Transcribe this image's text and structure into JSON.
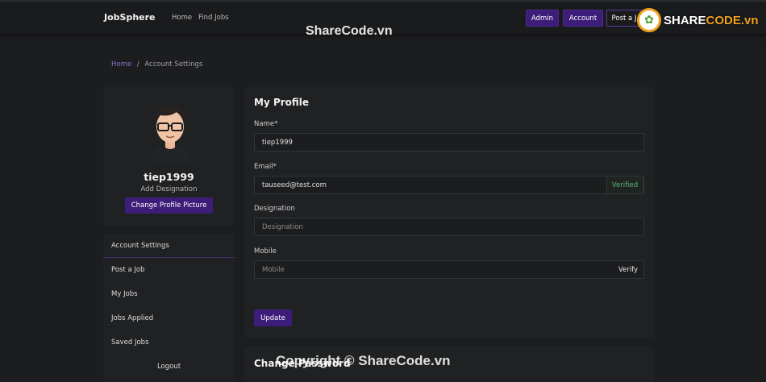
{
  "navbar": {
    "brand": "JobSphere",
    "links": [
      "Home",
      "Find Jobs"
    ],
    "buttons": [
      "Admin",
      "Account",
      "Post a J"
    ]
  },
  "watermark": {
    "top": "ShareCode.vn",
    "logo_prefix": "SHARE",
    "logo_suffix": "CODE.vn",
    "bottom": "Copyright © ShareCode.vn"
  },
  "breadcrumb": {
    "home": "Home",
    "separator": "/",
    "current": "Account Settings"
  },
  "profile": {
    "username": "tiep1999",
    "designation": "Add Designation",
    "change_picture_label": "Change Profile Picture"
  },
  "side_menu": {
    "items": [
      "Account Settings",
      "Post a Job",
      "My Jobs",
      "Jobs Applied",
      "Saved Jobs",
      "Logout"
    ]
  },
  "my_profile": {
    "title": "My Profile",
    "name_label": "Name*",
    "name_value": "tiep1999",
    "email_label": "Email*",
    "email_value": "tauseed@test.com",
    "email_status": "Verified",
    "designation_label": "Designation",
    "designation_placeholder": "Designation",
    "mobile_label": "Mobile",
    "mobile_placeholder": "Mobile",
    "mobile_action": "Verify",
    "update_label": "Update"
  },
  "change_password": {
    "title": "Change Password"
  },
  "colors": {
    "accent": "#3d1d7a",
    "link": "#8f74d6",
    "verified": "#5fb07a",
    "background": "#1c1d1f",
    "card": "#202123"
  }
}
